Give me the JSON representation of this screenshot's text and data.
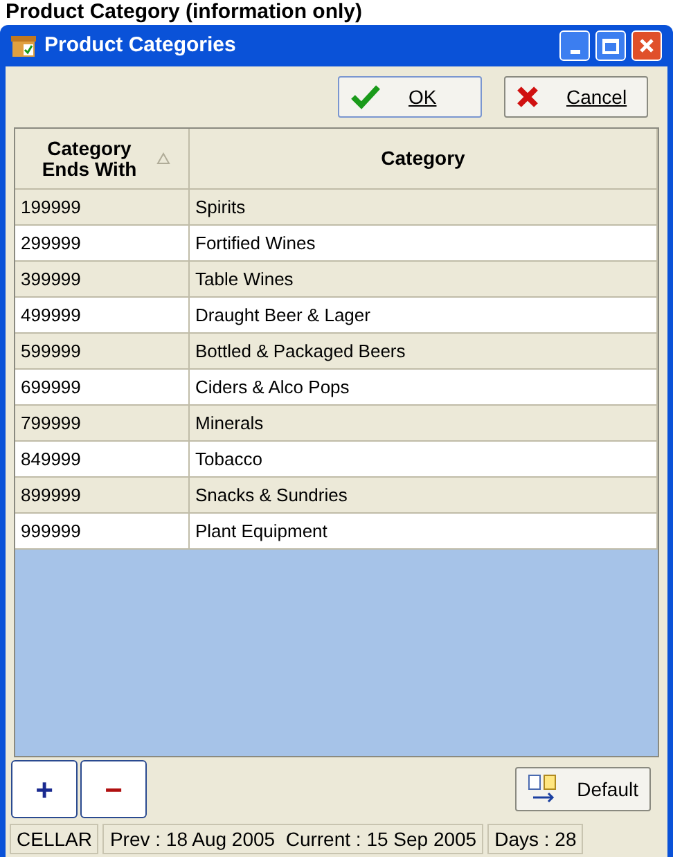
{
  "page_heading": "Product Category (information only)",
  "window": {
    "title": "Product Categories"
  },
  "toolbar": {
    "buttons": [
      {
        "kind": "ok",
        "label": "OK"
      },
      {
        "kind": "cancel",
        "label": "Cancel"
      }
    ]
  },
  "table": {
    "columns": [
      {
        "label": "Category Ends With",
        "sorted": true
      },
      {
        "label": "Category",
        "sorted": false
      }
    ],
    "rows": [
      {
        "cells": [
          "199999",
          "Spirits"
        ]
      },
      {
        "cells": [
          "299999",
          "Fortified Wines"
        ]
      },
      {
        "cells": [
          "399999",
          "Table Wines"
        ]
      },
      {
        "cells": [
          "499999",
          "Draught Beer & Lager"
        ]
      },
      {
        "cells": [
          "599999",
          "Bottled & Packaged Beers"
        ]
      },
      {
        "cells": [
          "699999",
          "Ciders & Alco Pops"
        ]
      },
      {
        "cells": [
          "799999",
          "Minerals"
        ]
      },
      {
        "cells": [
          "849999",
          "Tobacco"
        ]
      },
      {
        "cells": [
          "899999",
          "Snacks & Sundries"
        ]
      },
      {
        "cells": [
          "999999",
          "Plant Equipment"
        ]
      }
    ]
  },
  "bottom_buttons": [
    {
      "kind": "add",
      "label": "+"
    },
    {
      "kind": "remove",
      "label": "−"
    },
    {
      "kind": "default",
      "label": "Default"
    }
  ],
  "status_bar": [
    "CELLAR",
    "Prev : 18 Aug 2005  Current : 15 Sep 2005",
    "Days : 28"
  ]
}
